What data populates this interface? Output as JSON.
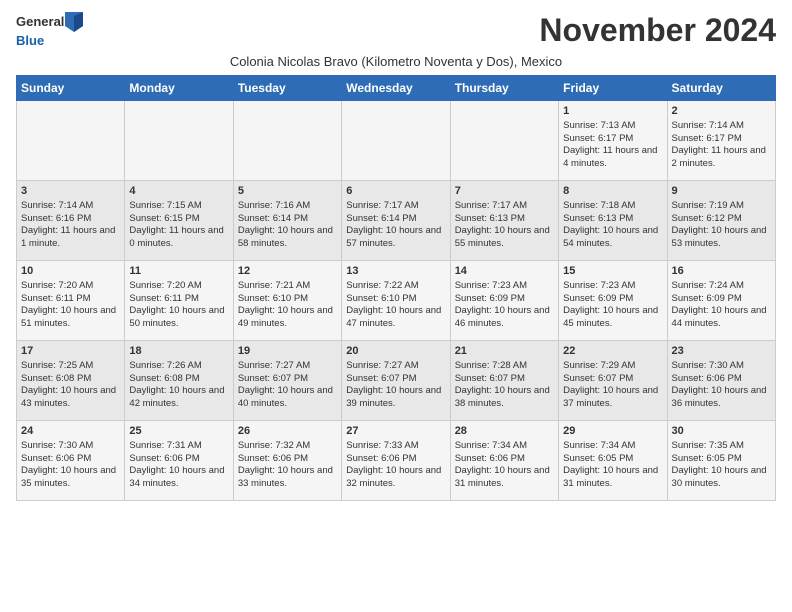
{
  "header": {
    "logo_general": "General",
    "logo_blue": "Blue",
    "month_title": "November 2024",
    "subtitle": "Colonia Nicolas Bravo (Kilometro Noventa y Dos), Mexico"
  },
  "days_of_week": [
    "Sunday",
    "Monday",
    "Tuesday",
    "Wednesday",
    "Thursday",
    "Friday",
    "Saturday"
  ],
  "weeks": [
    [
      {
        "day": "",
        "info": ""
      },
      {
        "day": "",
        "info": ""
      },
      {
        "day": "",
        "info": ""
      },
      {
        "day": "",
        "info": ""
      },
      {
        "day": "",
        "info": ""
      },
      {
        "day": "1",
        "info": "Sunrise: 7:13 AM\nSunset: 6:17 PM\nDaylight: 11 hours and 4 minutes."
      },
      {
        "day": "2",
        "info": "Sunrise: 7:14 AM\nSunset: 6:17 PM\nDaylight: 11 hours and 2 minutes."
      }
    ],
    [
      {
        "day": "3",
        "info": "Sunrise: 7:14 AM\nSunset: 6:16 PM\nDaylight: 11 hours and 1 minute."
      },
      {
        "day": "4",
        "info": "Sunrise: 7:15 AM\nSunset: 6:15 PM\nDaylight: 11 hours and 0 minutes."
      },
      {
        "day": "5",
        "info": "Sunrise: 7:16 AM\nSunset: 6:14 PM\nDaylight: 10 hours and 58 minutes."
      },
      {
        "day": "6",
        "info": "Sunrise: 7:17 AM\nSunset: 6:14 PM\nDaylight: 10 hours and 57 minutes."
      },
      {
        "day": "7",
        "info": "Sunrise: 7:17 AM\nSunset: 6:13 PM\nDaylight: 10 hours and 55 minutes."
      },
      {
        "day": "8",
        "info": "Sunrise: 7:18 AM\nSunset: 6:13 PM\nDaylight: 10 hours and 54 minutes."
      },
      {
        "day": "9",
        "info": "Sunrise: 7:19 AM\nSunset: 6:12 PM\nDaylight: 10 hours and 53 minutes."
      }
    ],
    [
      {
        "day": "10",
        "info": "Sunrise: 7:20 AM\nSunset: 6:11 PM\nDaylight: 10 hours and 51 minutes."
      },
      {
        "day": "11",
        "info": "Sunrise: 7:20 AM\nSunset: 6:11 PM\nDaylight: 10 hours and 50 minutes."
      },
      {
        "day": "12",
        "info": "Sunrise: 7:21 AM\nSunset: 6:10 PM\nDaylight: 10 hours and 49 minutes."
      },
      {
        "day": "13",
        "info": "Sunrise: 7:22 AM\nSunset: 6:10 PM\nDaylight: 10 hours and 47 minutes."
      },
      {
        "day": "14",
        "info": "Sunrise: 7:23 AM\nSunset: 6:09 PM\nDaylight: 10 hours and 46 minutes."
      },
      {
        "day": "15",
        "info": "Sunrise: 7:23 AM\nSunset: 6:09 PM\nDaylight: 10 hours and 45 minutes."
      },
      {
        "day": "16",
        "info": "Sunrise: 7:24 AM\nSunset: 6:09 PM\nDaylight: 10 hours and 44 minutes."
      }
    ],
    [
      {
        "day": "17",
        "info": "Sunrise: 7:25 AM\nSunset: 6:08 PM\nDaylight: 10 hours and 43 minutes."
      },
      {
        "day": "18",
        "info": "Sunrise: 7:26 AM\nSunset: 6:08 PM\nDaylight: 10 hours and 42 minutes."
      },
      {
        "day": "19",
        "info": "Sunrise: 7:27 AM\nSunset: 6:07 PM\nDaylight: 10 hours and 40 minutes."
      },
      {
        "day": "20",
        "info": "Sunrise: 7:27 AM\nSunset: 6:07 PM\nDaylight: 10 hours and 39 minutes."
      },
      {
        "day": "21",
        "info": "Sunrise: 7:28 AM\nSunset: 6:07 PM\nDaylight: 10 hours and 38 minutes."
      },
      {
        "day": "22",
        "info": "Sunrise: 7:29 AM\nSunset: 6:07 PM\nDaylight: 10 hours and 37 minutes."
      },
      {
        "day": "23",
        "info": "Sunrise: 7:30 AM\nSunset: 6:06 PM\nDaylight: 10 hours and 36 minutes."
      }
    ],
    [
      {
        "day": "24",
        "info": "Sunrise: 7:30 AM\nSunset: 6:06 PM\nDaylight: 10 hours and 35 minutes."
      },
      {
        "day": "25",
        "info": "Sunrise: 7:31 AM\nSunset: 6:06 PM\nDaylight: 10 hours and 34 minutes."
      },
      {
        "day": "26",
        "info": "Sunrise: 7:32 AM\nSunset: 6:06 PM\nDaylight: 10 hours and 33 minutes."
      },
      {
        "day": "27",
        "info": "Sunrise: 7:33 AM\nSunset: 6:06 PM\nDaylight: 10 hours and 32 minutes."
      },
      {
        "day": "28",
        "info": "Sunrise: 7:34 AM\nSunset: 6:06 PM\nDaylight: 10 hours and 31 minutes."
      },
      {
        "day": "29",
        "info": "Sunrise: 7:34 AM\nSunset: 6:05 PM\nDaylight: 10 hours and 31 minutes."
      },
      {
        "day": "30",
        "info": "Sunrise: 7:35 AM\nSunset: 6:05 PM\nDaylight: 10 hours and 30 minutes."
      }
    ]
  ]
}
